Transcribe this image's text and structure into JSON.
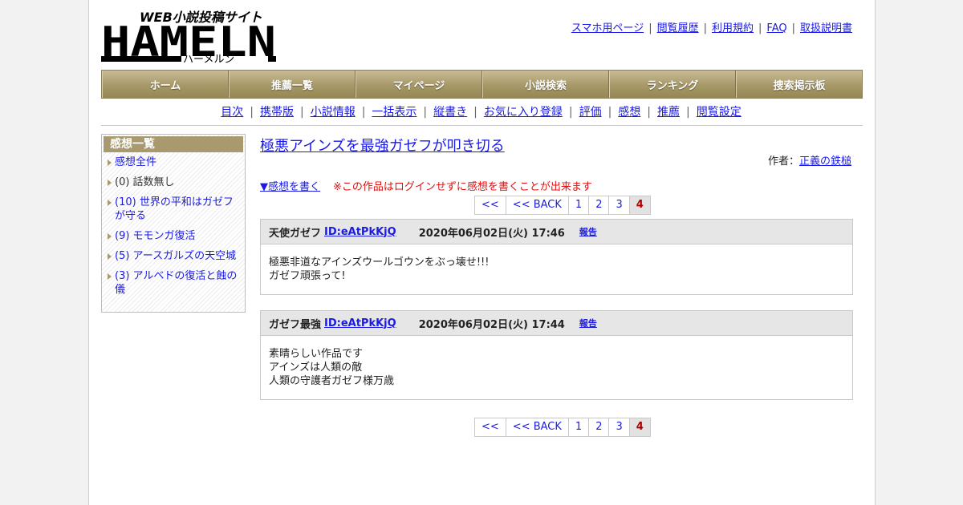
{
  "logo": {
    "tagline": "WEB小説投稿サイト",
    "wordmark": "HAMELN",
    "kana": "ハーメルン"
  },
  "top_links": [
    "スマホ用ページ",
    "閲覧履歴",
    "利用規約",
    "FAQ",
    "取扱説明書"
  ],
  "main_nav": [
    "ホーム",
    "推薦一覧",
    "マイページ",
    "小説検索",
    "ランキング",
    "捜索掲示板"
  ],
  "sub_nav": [
    "目次",
    "携帯版",
    "小説情報",
    "一括表示",
    "縦書き",
    "お気に入り登録",
    "評価",
    "感想",
    "推薦",
    "閲覧設定"
  ],
  "sidebar": {
    "title": "感想一覧",
    "items": [
      {
        "label": "感想全件",
        "link": true
      },
      {
        "label": "(0) 話数無し",
        "link": false
      },
      {
        "label": "(10) 世界の平和はガゼフが守る",
        "link": true
      },
      {
        "label": "(9) モモンガ復活",
        "link": true
      },
      {
        "label": "(5) アースガルズの天空城",
        "link": true
      },
      {
        "label": "(3) アルベドの復活と蝕の儀",
        "link": true
      }
    ]
  },
  "work": {
    "title": "極悪アインズを最強ガゼフが叩き切る",
    "author_label": "作者：",
    "author": "正義の鉄槌"
  },
  "write": {
    "link": "▼感想を書く",
    "note": "※この作品はログインせずに感想を書くことが出来ます"
  },
  "pager": {
    "first": "<<",
    "back": "<< BACK",
    "pages": [
      "1",
      "2",
      "3",
      "4"
    ],
    "current": "4"
  },
  "comments": [
    {
      "name": "天使ガゼフ",
      "id": "ID:eAtPkKjQ",
      "date": "2020年06月02日(火) 17:46",
      "report": "報告",
      "lines": [
        "極悪非道なアインズウールゴウンをぶっ壊せ!!!",
        "ガゼフ頑張って!"
      ]
    },
    {
      "name": "ガゼフ最強",
      "id": "ID:eAtPkKjQ",
      "date": "2020年06月02日(火) 17:44",
      "report": "報告",
      "lines": [
        "素晴らしい作品です",
        "アインズは人類の敵",
        "人類の守護者ガゼフ様万歳"
      ]
    }
  ],
  "colors": {
    "nav_gold": "#a69868",
    "link": "#1a1ae6",
    "note_red": "#e01010",
    "current_page": "#b00000"
  }
}
